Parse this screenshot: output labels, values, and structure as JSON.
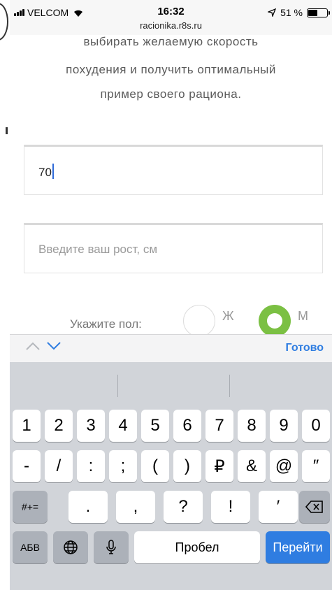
{
  "status_bar": {
    "carrier": "VELCOM",
    "time": "16:32",
    "url": "racionika.r8s.ru",
    "battery": "51 %",
    "battery_level": 0.51
  },
  "page": {
    "description_lines": [
      "выбирать желаемую скорость",
      "похудения и получить оптимальный",
      "пример своего рациона."
    ],
    "weight_input": {
      "value": "70"
    },
    "height_input": {
      "placeholder": "Введите ваш рост, см"
    },
    "gender": {
      "label": "Укажите пол:",
      "female": "Ж",
      "male": "М",
      "selected": "М"
    }
  },
  "accessory_bar": {
    "done": "Готово"
  },
  "keyboard": {
    "row1": [
      "1",
      "2",
      "3",
      "4",
      "5",
      "6",
      "7",
      "8",
      "9",
      "0"
    ],
    "row2": [
      "-",
      "/",
      ":",
      ";",
      "(",
      ")",
      "₽",
      "&",
      "@",
      "″"
    ],
    "row3": [
      ".",
      ",",
      "?",
      "!",
      "′"
    ],
    "mode_key": "#+=",
    "abc_key": "АБВ",
    "space": "Пробел",
    "go": "Перейти"
  },
  "colors": {
    "accent_green": "#7bc043",
    "ios_blue": "#2f7de1"
  }
}
